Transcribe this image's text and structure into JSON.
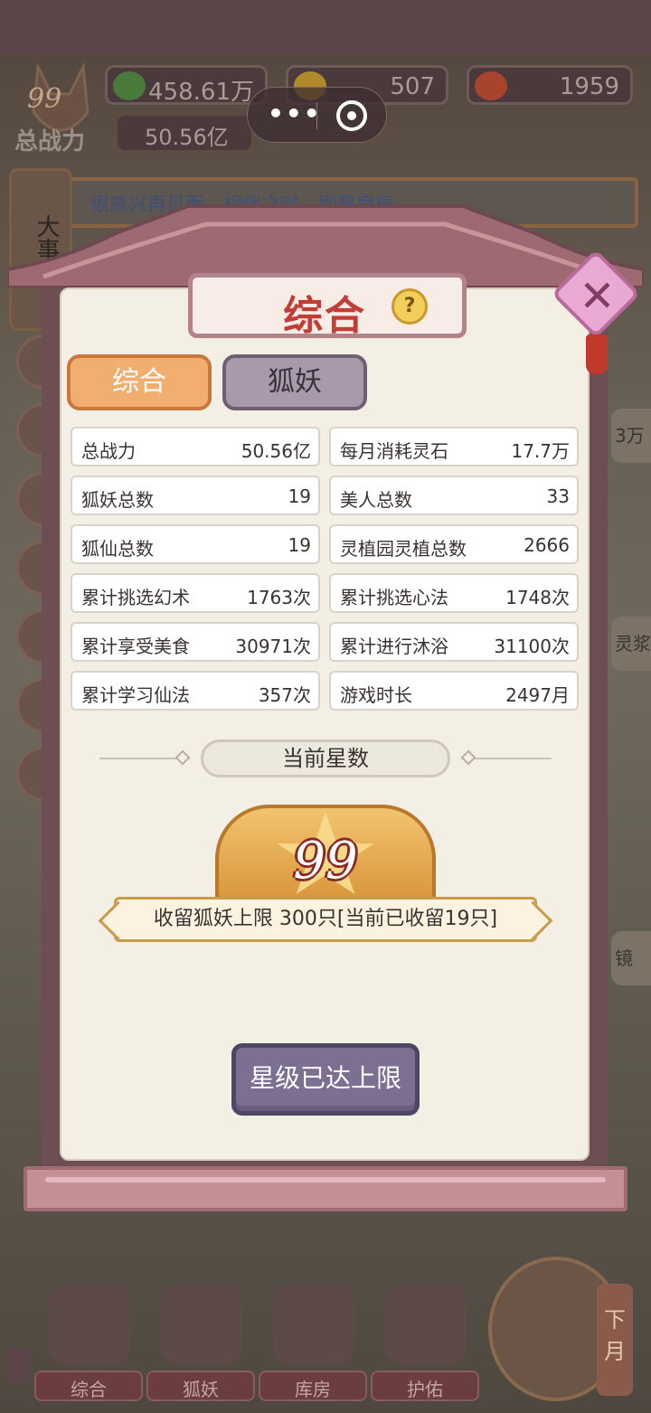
{
  "resources": [
    {
      "icon": "leaf-coin-icon",
      "value": "458.61万"
    },
    {
      "icon": "gold-ingot-icon",
      "value": "507"
    },
    {
      "icon": "peach-icon",
      "value": "1959"
    }
  ],
  "player": {
    "level": "99",
    "power_label": "总战力",
    "power_value": "50.56亿"
  },
  "notice": "很高兴再见面，相伴之时，即是良辰",
  "side_scroll_label": "大事",
  "right_edge": {
    "item1": "3万",
    "item2": "灵浆",
    "item3": "镜"
  },
  "modal": {
    "title": "综合",
    "tabs": [
      {
        "label": "综合",
        "active": true
      },
      {
        "label": "狐妖",
        "active": false
      }
    ],
    "stats": [
      {
        "key": "总战力",
        "value": "50.56亿"
      },
      {
        "key": "每月消耗灵石",
        "value": "17.7万"
      },
      {
        "key": "狐妖总数",
        "value": "19"
      },
      {
        "key": "美人总数",
        "value": "33"
      },
      {
        "key": "狐仙总数",
        "value": "19"
      },
      {
        "key": "灵植园灵植总数",
        "value": "2666"
      },
      {
        "key": "累计挑选幻术",
        "value": "1763次"
      },
      {
        "key": "累计挑选心法",
        "value": "1748次"
      },
      {
        "key": "累计享受美食",
        "value": "30971次"
      },
      {
        "key": "累计进行沐浴",
        "value": "31100次"
      },
      {
        "key": "累计学习仙法",
        "value": "357次"
      },
      {
        "key": "游戏时长",
        "value": "2497月"
      }
    ],
    "star_header": "当前星数",
    "star_level": "99",
    "capacity_text": "收留狐妖上限 300只[当前已收留19只]",
    "max_button": "星级已达上限"
  },
  "bottom_nav": [
    {
      "label": "综合",
      "icon": "pavilion-icon"
    },
    {
      "label": "狐妖",
      "icon": "fox-mask-icon"
    },
    {
      "label": "库房",
      "icon": "storage-box-icon"
    },
    {
      "label": "护佑",
      "icon": "lotus-icon"
    }
  ],
  "month_button": "下月",
  "colors": {
    "title_red": "#c33d37",
    "tab_active": "#f2ae6e",
    "tab_inactive": "#a89aab",
    "button_purple": "#7d6f92"
  }
}
